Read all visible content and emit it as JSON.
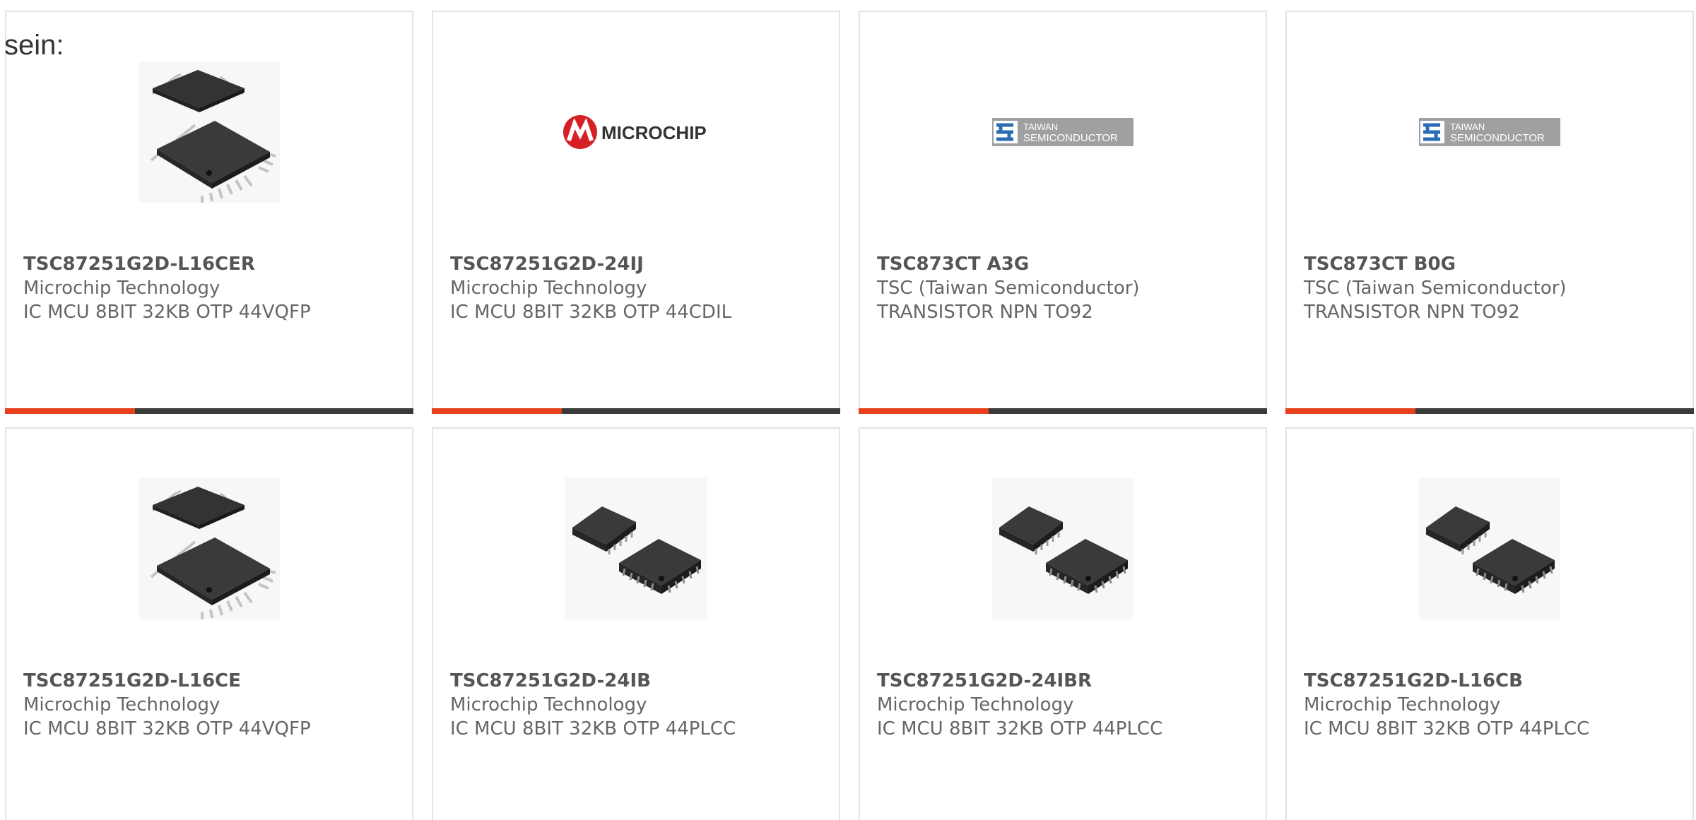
{
  "intro": {
    "text": "sein:"
  },
  "products": [
    {
      "part": "TSC87251G2D-L16CER",
      "manufacturer": "Microchip Technology",
      "description": "IC MCU 8BIT 32KB OTP 44VQFP",
      "image": "vqfp-chip-image"
    },
    {
      "part": "TSC87251G2D-24IJ",
      "manufacturer": "Microchip Technology",
      "description": "IC MCU 8BIT 32KB OTP 44CDIL",
      "image": "microchip-logo",
      "logo_text": "MICROCHIP"
    },
    {
      "part": "TSC873CT A3G",
      "manufacturer": "TSC (Taiwan Semiconductor)",
      "description": "TRANSISTOR NPN TO92",
      "image": "taiwan-semiconductor-logo",
      "logo_text": [
        "TAIWAN",
        "SEMICONDUCTOR"
      ]
    },
    {
      "part": "TSC873CT B0G",
      "manufacturer": "TSC (Taiwan Semiconductor)",
      "description": "TRANSISTOR NPN TO92",
      "image": "taiwan-semiconductor-logo",
      "logo_text": [
        "TAIWAN",
        "SEMICONDUCTOR"
      ]
    },
    {
      "part": "TSC87251G2D-L16CE",
      "manufacturer": "Microchip Technology",
      "description": "IC MCU 8BIT 32KB OTP 44VQFP",
      "image": "vqfp-chip-image"
    },
    {
      "part": "TSC87251G2D-24IB",
      "manufacturer": "Microchip Technology",
      "description": "IC MCU 8BIT 32KB OTP 44PLCC",
      "image": "plcc-chip-image"
    },
    {
      "part": "TSC87251G2D-24IBR",
      "manufacturer": "Microchip Technology",
      "description": "IC MCU 8BIT 32KB OTP 44PLCC",
      "image": "plcc-chip-image"
    },
    {
      "part": "TSC87251G2D-L16CB",
      "manufacturer": "Microchip Technology",
      "description": "IC MCU 8BIT 32KB OTP 44PLCC",
      "image": "plcc-chip-image"
    }
  ],
  "colors": {
    "accent": "#e8401c",
    "bar": "#3a3a3a",
    "card_border": "#e3e3e3",
    "microchip_red": "#d71f26",
    "tsc_blue": "#2a6cb3",
    "tsc_gray": "#9ea0a2"
  }
}
